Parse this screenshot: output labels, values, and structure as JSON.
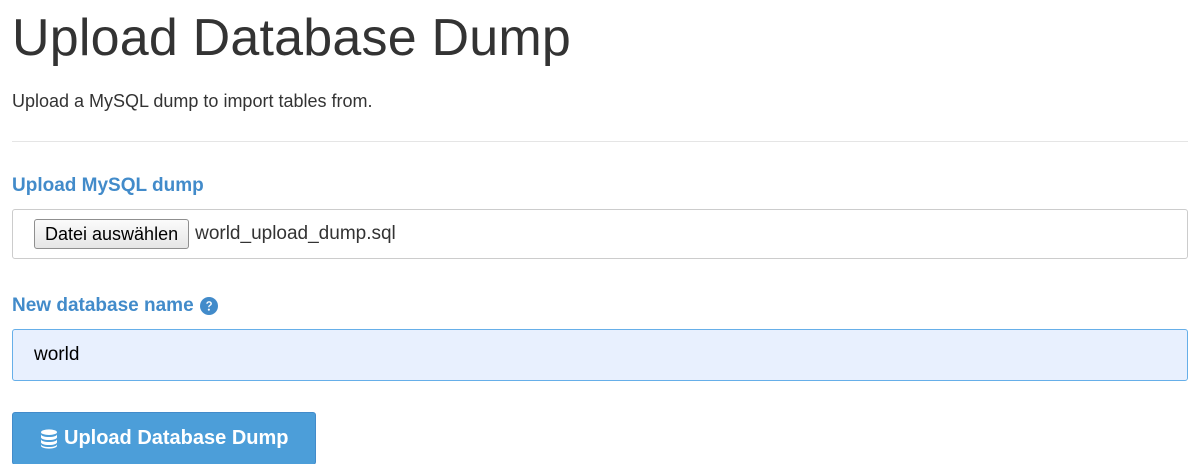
{
  "header": {
    "title": "Upload Database Dump",
    "subtitle": "Upload a MySQL dump to import tables from."
  },
  "form": {
    "dump_field": {
      "label": "Upload MySQL dump",
      "button_label": "Datei auswählen",
      "file_name": "world_upload_dump.sql"
    },
    "name_field": {
      "label": "New database name",
      "value": "world",
      "help_icon": "question-circle-icon"
    },
    "submit": {
      "label": "Upload Database Dump",
      "icon": "database-icon"
    }
  },
  "colors": {
    "label": "#428bca",
    "button": "#4c9ed9",
    "input_background": "#e8f0fe",
    "input_border": "#66afe9"
  }
}
